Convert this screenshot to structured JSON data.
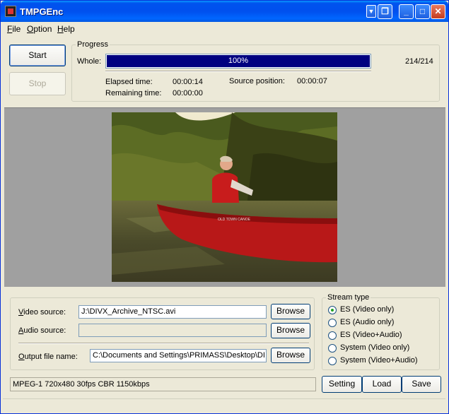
{
  "window": {
    "title": "TMPGEnc",
    "controls": {
      "sys": "▼",
      "restore_alt": "❐",
      "minimize": "_",
      "maximize": "□",
      "close": "✕"
    }
  },
  "menu": {
    "file": "File",
    "option": "Option",
    "help": "Help"
  },
  "actions": {
    "start": "Start",
    "stop": "Stop"
  },
  "progress": {
    "group_title": "Progress",
    "whole_label": "Whole:",
    "percent_text": "100%",
    "fraction": 1.0,
    "count": "214/214",
    "elapsed_label": "Elapsed time:",
    "elapsed_value": "00:00:14",
    "remaining_label": "Remaining time:",
    "remaining_value": "00:00:00",
    "source_pos_label": "Source position:",
    "source_pos_value": "00:00:07"
  },
  "sources": {
    "video_label": "Video source:",
    "video_value": "J:\\DIVX_Archive_NTSC.avi",
    "audio_label": "Audio source:",
    "audio_value": "",
    "output_label": "Output file name:",
    "output_value": "C:\\Documents and Settings\\PRIMASS\\Desktop\\DI",
    "browse": "Browse"
  },
  "stream_type": {
    "title": "Stream type",
    "options": [
      {
        "label": "ES (Video only)",
        "checked": true
      },
      {
        "label": "ES (Audio only)",
        "checked": false
      },
      {
        "label": "ES (Video+Audio)",
        "checked": false
      },
      {
        "label": "System (Video only)",
        "checked": false
      },
      {
        "label": "System (Video+Audio)",
        "checked": false
      }
    ]
  },
  "encode_settings": "MPEG-1 720x480 30fps CBR 1150kbps",
  "bottom_buttons": {
    "setting": "Setting",
    "load": "Load",
    "save": "Save"
  },
  "colors": {
    "titlebar": "#0054e3",
    "progress_fill": "#000080",
    "face": "#ece9d8"
  }
}
